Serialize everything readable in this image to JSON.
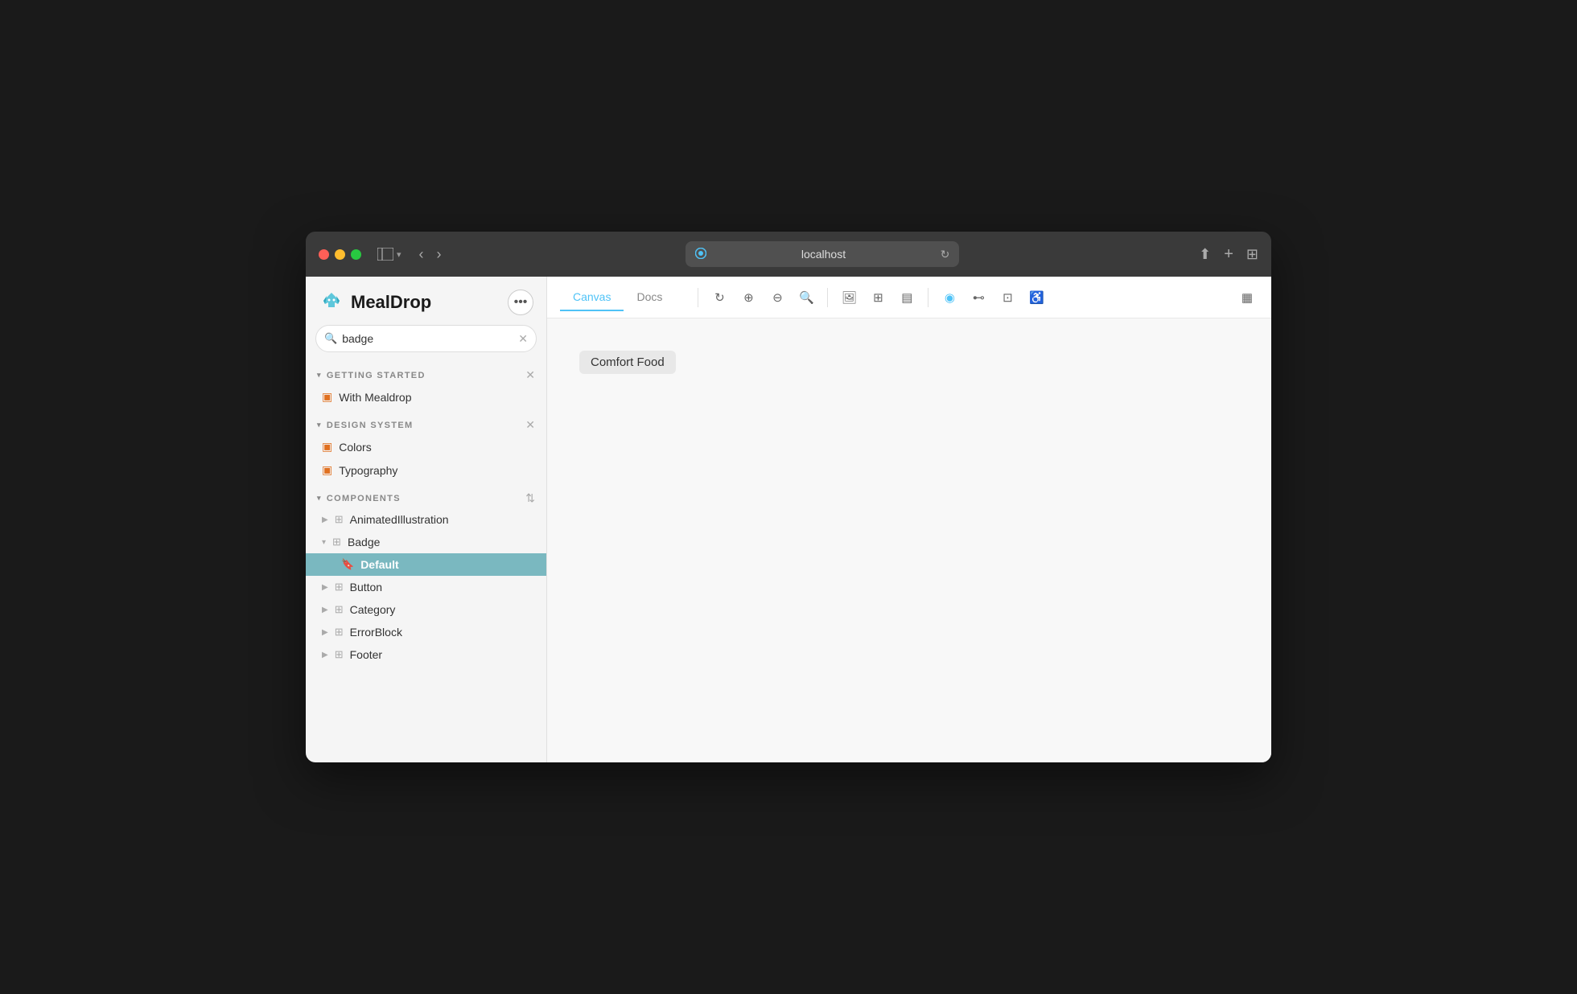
{
  "titleBar": {
    "url": "localhost",
    "icons": {
      "sidebar": "⊞",
      "back": "‹",
      "forward": "›",
      "share": "⬆",
      "newTab": "+",
      "tabs": "⊞"
    }
  },
  "sidebar": {
    "logo": {
      "text": "MealDrop"
    },
    "search": {
      "placeholder": "badge",
      "value": "badge"
    },
    "sections": [
      {
        "id": "getting-started",
        "title": "GETTING STARTED",
        "items": [
          {
            "id": "with-mealdrop",
            "label": "With Mealdrop",
            "type": "page"
          }
        ]
      },
      {
        "id": "design-system",
        "title": "DESIGN SYSTEM",
        "items": [
          {
            "id": "colors",
            "label": "Colors",
            "type": "page"
          },
          {
            "id": "typography",
            "label": "Typography",
            "type": "page"
          }
        ]
      },
      {
        "id": "components",
        "title": "COMPONENTS",
        "items": [
          {
            "id": "animated-illustration",
            "label": "AnimatedIllustration",
            "type": "component",
            "expanded": false
          },
          {
            "id": "badge",
            "label": "Badge",
            "type": "component",
            "expanded": true,
            "children": [
              {
                "id": "badge-default",
                "label": "Default",
                "active": true
              }
            ]
          },
          {
            "id": "button",
            "label": "Button",
            "type": "component",
            "expanded": false
          },
          {
            "id": "category",
            "label": "Category",
            "type": "component",
            "expanded": false
          },
          {
            "id": "error-block",
            "label": "ErrorBlock",
            "type": "component",
            "expanded": false
          },
          {
            "id": "footer",
            "label": "Footer",
            "type": "component",
            "expanded": false
          }
        ]
      }
    ]
  },
  "canvasToolbar": {
    "tabs": [
      {
        "id": "canvas",
        "label": "Canvas",
        "active": true
      },
      {
        "id": "docs",
        "label": "Docs",
        "active": false
      }
    ]
  },
  "canvas": {
    "badge": {
      "label": "Comfort Food"
    }
  }
}
